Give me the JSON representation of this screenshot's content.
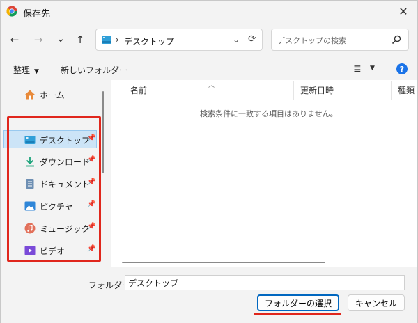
{
  "window": {
    "title": "保存先",
    "close_glyph": "✕"
  },
  "nav": {
    "back_glyph": "←",
    "forward_glyph": "→",
    "recent_glyph": "⌄",
    "up_glyph": "↑",
    "chevron": "›",
    "path": "デスクトップ",
    "dropdown_glyph": "⌄",
    "refresh_glyph": "⟳"
  },
  "search": {
    "placeholder": "デスクトップの検索"
  },
  "toolbar": {
    "organize_label": "整理",
    "caret": "▼",
    "new_folder_label": "新しいフォルダー",
    "view_glyph": "≣",
    "view_caret": "▼",
    "help_glyph": "?"
  },
  "sidebar": {
    "items": [
      {
        "label": "ホーム",
        "icon": "home-icon",
        "pinned": false
      },
      {
        "label": "デスクトップ",
        "icon": "desktop-icon",
        "pinned": true,
        "selected": true
      },
      {
        "label": "ダウンロード",
        "icon": "download-icon",
        "pinned": true
      },
      {
        "label": "ドキュメント",
        "icon": "document-icon",
        "pinned": true
      },
      {
        "label": "ピクチャ",
        "icon": "pictures-icon",
        "pinned": true
      },
      {
        "label": "ミュージック",
        "icon": "music-icon",
        "pinned": true
      },
      {
        "label": "ビデオ",
        "icon": "video-icon",
        "pinned": true
      }
    ],
    "pin_glyph": "📌"
  },
  "filelist": {
    "columns": [
      "名前",
      "更新日時",
      "種類"
    ],
    "sort_glyph": "︿",
    "empty_message": "検索条件に一致する項目はありません。"
  },
  "footer": {
    "folder_label": "フォルダー:",
    "folder_value": "デスクトップ",
    "select_button": "フォルダーの選択",
    "cancel_button": "キャンセル"
  },
  "colors": {
    "accent": "#0067c0",
    "highlight_annotation": "#e0261c",
    "selected_bg": "#cce4f7"
  }
}
